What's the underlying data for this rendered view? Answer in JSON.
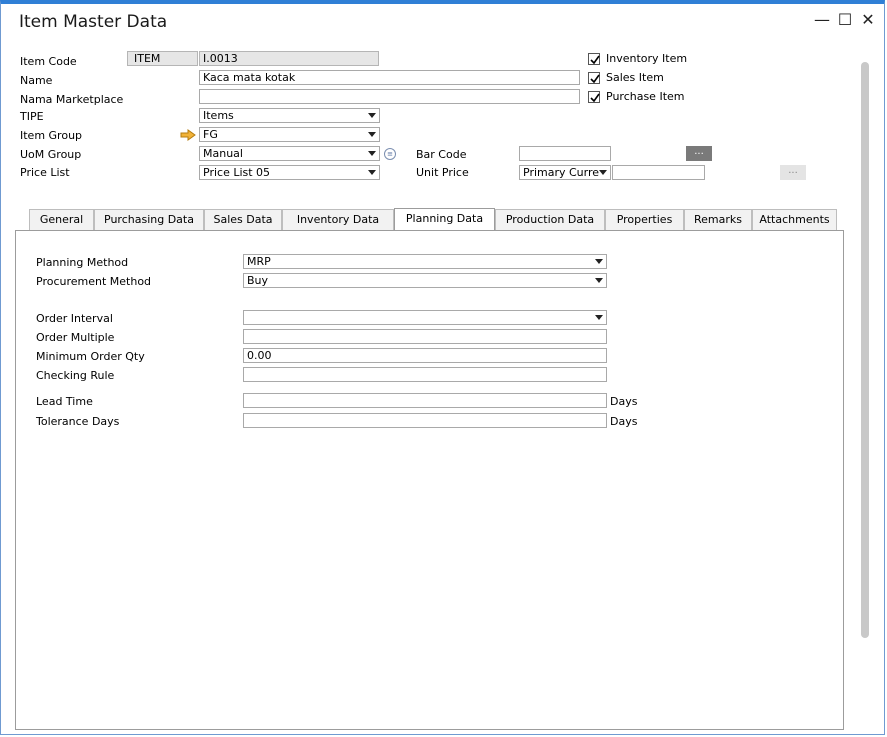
{
  "window": {
    "title": "Item Master Data",
    "minimize_icon": "minimize-icon",
    "maximize_icon": "maximize-icon",
    "close_icon": "close-icon"
  },
  "header": {
    "item_code": {
      "label": "Item Code",
      "series": "ITEM",
      "value": "I.0013"
    },
    "name": {
      "label": "Name",
      "value": "Kaca mata kotak"
    },
    "nama_marketplace": {
      "label": "Nama Marketplace",
      "value": ""
    },
    "tipe": {
      "label": "TIPE",
      "value": "Items"
    },
    "item_group": {
      "label": "Item Group",
      "value": "FG",
      "link_icon": "arrow-right-icon"
    },
    "uom_group": {
      "label": "UoM Group",
      "value": "Manual",
      "info_icon": "list-icon"
    },
    "price_list": {
      "label": "Price List",
      "value": "Price List 05"
    },
    "bar_code": {
      "label": "Bar Code",
      "value": "",
      "button": "..."
    },
    "unit_price": {
      "label": "Unit Price",
      "currency": "Primary Curre",
      "value": "",
      "button": "..."
    },
    "checkboxes": [
      {
        "label": "Inventory Item",
        "checked": true
      },
      {
        "label": "Sales Item",
        "checked": true
      },
      {
        "label": "Purchase Item",
        "checked": true
      }
    ]
  },
  "tabs": [
    {
      "label": "General",
      "active": false
    },
    {
      "label": "Purchasing Data",
      "active": false
    },
    {
      "label": "Sales Data",
      "active": false
    },
    {
      "label": "Inventory Data",
      "active": false
    },
    {
      "label": "Planning Data",
      "active": true
    },
    {
      "label": "Production Data",
      "active": false
    },
    {
      "label": "Properties",
      "active": false
    },
    {
      "label": "Remarks",
      "active": false
    },
    {
      "label": "Attachments",
      "active": false
    }
  ],
  "planning": {
    "planning_method": {
      "label": "Planning Method",
      "value": "MRP"
    },
    "procurement_method": {
      "label": "Procurement Method",
      "value": "Buy"
    },
    "order_interval": {
      "label": "Order Interval",
      "value": ""
    },
    "order_multiple": {
      "label": "Order Multiple",
      "value": ""
    },
    "minimum_order_qty": {
      "label": "Minimum Order Qty",
      "value": "0.00"
    },
    "checking_rule": {
      "label": "Checking Rule",
      "value": ""
    },
    "lead_time": {
      "label": "Lead Time",
      "value": "",
      "unit": "Days"
    },
    "tolerance_days": {
      "label": "Tolerance Days",
      "value": "",
      "unit": "Days"
    }
  },
  "colors": {
    "accent": "#2f7fd6",
    "field_border": "#a9a9a9",
    "grey_field": "#e6e6e6",
    "link_arrow": "#e8a317"
  }
}
